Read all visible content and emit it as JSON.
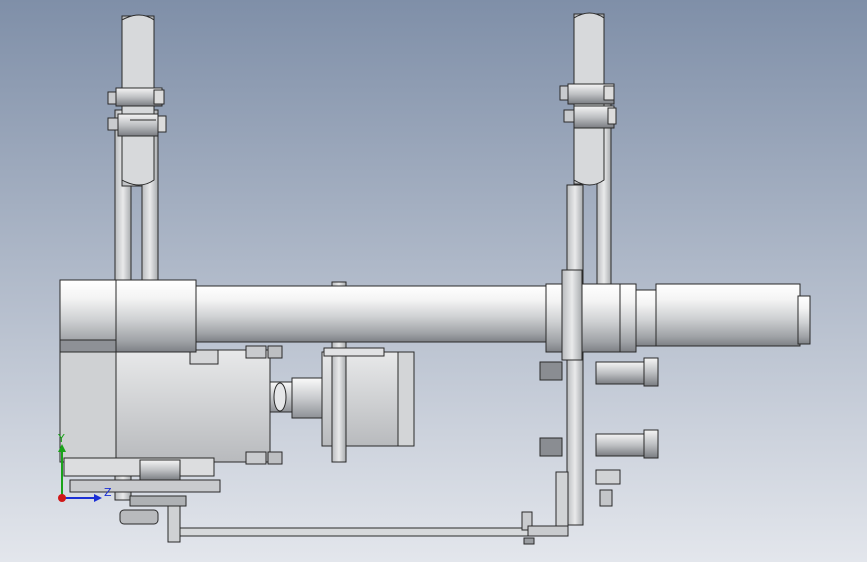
{
  "viewport": {
    "background_top": "#7f8fa8",
    "background_bottom": "#e3e6ec"
  },
  "model": {
    "metal_light": "#f1f2f3",
    "metal_mid": "#c6c8cb",
    "metal_dark": "#8c9096",
    "edge": "#2a2a2a"
  },
  "triad": {
    "y_label": "Y",
    "z_label": "Z",
    "y_color": "#1aa31a",
    "z_color": "#1a2fd6",
    "origin_color": "#d01818"
  }
}
